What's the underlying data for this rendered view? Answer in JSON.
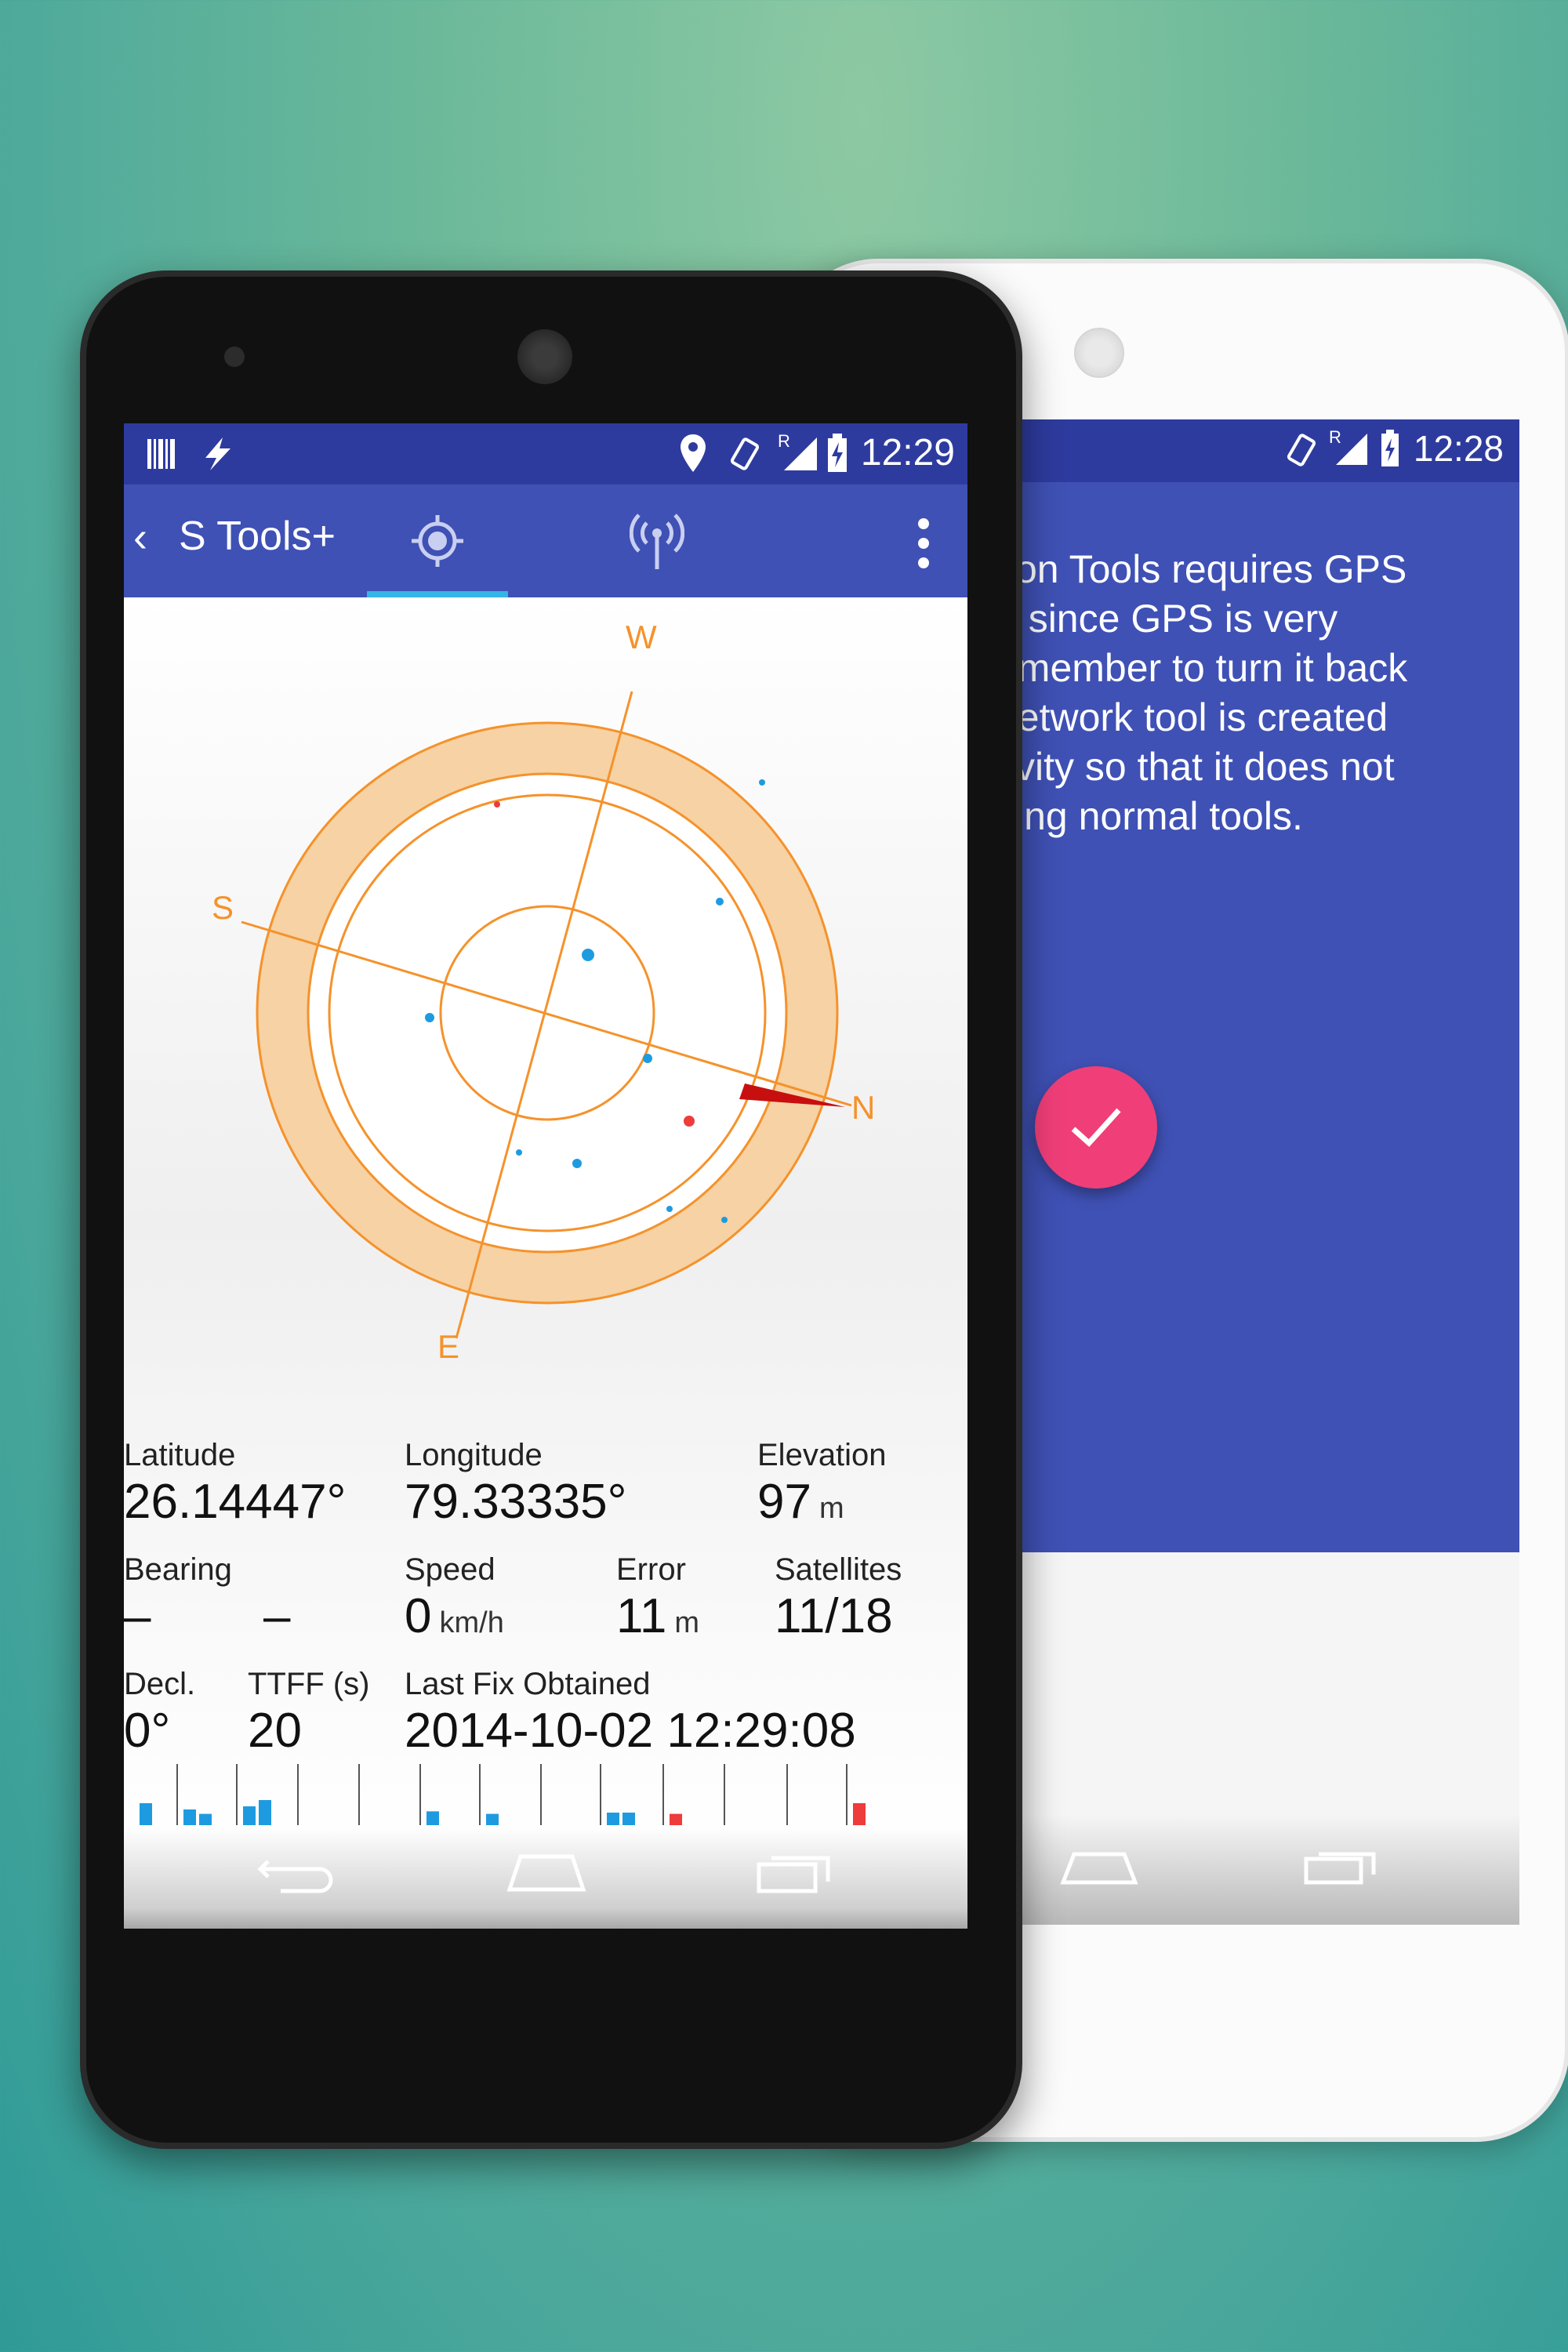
{
  "front_phone": {
    "status_bar": {
      "time": "12:29",
      "roaming": "R"
    },
    "app_bar": {
      "title": "S Tools+",
      "active_tab": "gps"
    },
    "compass": {
      "north": "N",
      "south": "S",
      "east": "E",
      "west": "W"
    },
    "stats": {
      "latitude": {
        "label": "Latitude",
        "value": "26.14447°"
      },
      "longitude": {
        "label": "Longitude",
        "value": "79.33335°"
      },
      "elevation": {
        "label": "Elevation",
        "value": "97",
        "unit": "m"
      },
      "bearing": {
        "label": "Bearing",
        "value": "–",
        "value2": "–"
      },
      "speed": {
        "label": "Speed",
        "value": "0",
        "unit": "km/h"
      },
      "error": {
        "label": "Error",
        "value": "11",
        "unit": "m"
      },
      "satellites": {
        "label": "Satellites",
        "value": "11/18"
      },
      "declination": {
        "label": "Decl.",
        "value": "0°"
      },
      "ttff": {
        "label": "TTFF (s)",
        "value": "20"
      },
      "last_fix": {
        "label": "Last Fix Obtained",
        "value": "2014-10-02 12:29:08"
      }
    },
    "signal_bars": [
      {
        "level": 0.35,
        "color": "#1e9be0"
      },
      {
        "level": 0.25,
        "color": "#1e9be0"
      },
      {
        "level": 0.18,
        "color": "#1e9be0"
      },
      {
        "level": 0.3,
        "color": "#1e9be0"
      },
      {
        "level": 0.4,
        "color": "#1e9be0"
      },
      {
        "level": 0.0,
        "color": "#1e9be0"
      },
      {
        "level": 0.0,
        "color": "#1e9be0"
      },
      {
        "level": 0.22,
        "color": "#1e9be0"
      },
      {
        "level": 0.18,
        "color": "#1e9be0"
      },
      {
        "level": 0.0,
        "color": "#1e9be0"
      },
      {
        "level": 0.2,
        "color": "#1e9be0"
      },
      {
        "level": 0.2,
        "color": "#1e9be0"
      },
      {
        "level": 0.18,
        "color": "#ee3b3b"
      },
      {
        "level": 0.0,
        "color": "#1e9be0"
      },
      {
        "level": 0.0,
        "color": "#1e9be0"
      },
      {
        "level": 0.35,
        "color": "#ee3b3b"
      }
    ],
    "colors": {
      "primary": "#3f51b5",
      "status": "#2e3b9e",
      "accent": "#35b5e5",
      "compass": "#f5922b",
      "ring": "#f6d2a4"
    }
  },
  "back_phone": {
    "status_bar": {
      "time": "12:28",
      "roaming": "R"
    },
    "message_lines": [
      "tion Tools requires GPS",
      "d since GPS is very",
      "emember to turn it back",
      " network tool is created",
      "tivity so that it does not",
      "sing normal tools."
    ],
    "fab_icon": "check-icon",
    "colors": {
      "primary": "#3f51b5",
      "fab": "#f03e78"
    }
  }
}
